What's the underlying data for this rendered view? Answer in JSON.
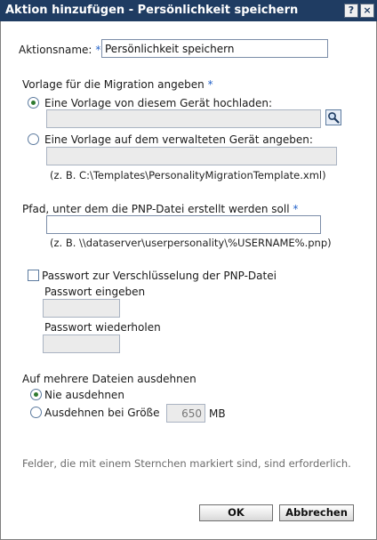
{
  "window": {
    "title": "Aktion hinzufügen - Persönlichkeit speichern",
    "help_label": "?",
    "close_label": "×"
  },
  "action_name": {
    "label": "Aktionsname:",
    "required_mark": "*",
    "value": "Persönlichkeit speichern"
  },
  "template": {
    "heading": "Vorlage für die Migration angeben",
    "required_mark": "*",
    "option_upload": {
      "label": "Eine Vorlage von diesem Gerät hochladen:",
      "value": "",
      "selected": true
    },
    "option_managed": {
      "label": "Eine Vorlage auf dem verwalteten Gerät angeben:",
      "value": "",
      "selected": false
    },
    "example": "(z. B. C:\\Templates\\PersonalityMigrationTemplate.xml)"
  },
  "pnp_path": {
    "label": "Pfad, unter dem die PNP-Datei erstellt werden soll",
    "required_mark": "*",
    "value": "",
    "example": "(z. B. \\\\dataserver\\userpersonality\\%USERNAME%.pnp)"
  },
  "password": {
    "checkbox_label": "Passwort zur Verschlüsselung der PNP-Datei",
    "checked": false,
    "enter_label": "Passwort eingeben",
    "repeat_label": "Passwort wiederholen"
  },
  "span": {
    "heading": "Auf mehrere Dateien ausdehnen",
    "option_never": {
      "label": "Nie ausdehnen",
      "selected": true
    },
    "option_size": {
      "label": "Ausdehnen bei Größe",
      "selected": false
    },
    "size_value": "650",
    "unit": "MB"
  },
  "footer_note": "Felder, die mit einem Sternchen markiert sind, sind erforderlich.",
  "buttons": {
    "ok": "OK",
    "cancel": "Abbrechen"
  },
  "colors": {
    "titlebar": "#1f3c62",
    "required": "#2563c9",
    "radio_dot": "#2f7a2f"
  },
  "icons": {
    "browse": "magnifier-icon"
  }
}
